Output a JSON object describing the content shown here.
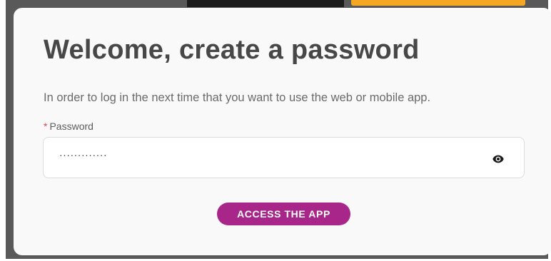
{
  "dialog": {
    "title": "Welcome, create a password",
    "subtitle": "In order to log in the next time that you want to use the web or mobile app.",
    "password_field": {
      "required_mark": "*",
      "label": "Password",
      "value": "·············",
      "toggle_icon": "eye-icon"
    },
    "submit_label": "ACCESS THE APP"
  },
  "colors": {
    "accent": "#a8258a",
    "title": "#474747",
    "required": "#e0454a",
    "backdrop": "#595959",
    "top_banner": "#f5a623"
  }
}
